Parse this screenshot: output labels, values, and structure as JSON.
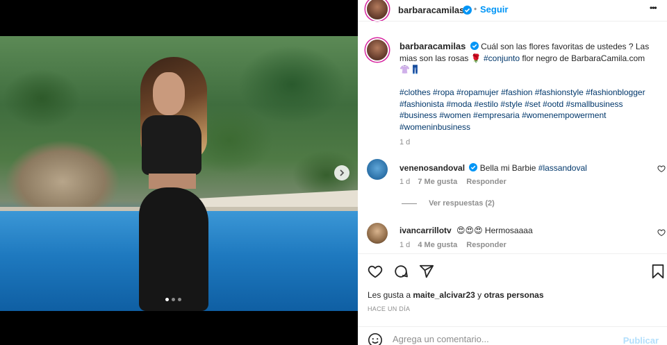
{
  "post": {
    "author": "barbaracamilas",
    "follow_label": "Seguir",
    "separator": "•",
    "more_label": "•••"
  },
  "caption": {
    "author": "barbaracamilas",
    "text_1": "Cuál son las flores favoritas de ustedes ? Las mias son las rosas 🌹",
    "hashtag_conjunto": "#conjunto",
    "text_2": "flor negro de BarbaraCamila.com 👚👖",
    "hashtags": "#clothes #ropa #ropamujer #fashion #fashionstyle #fashionblogger #fashionista #moda #estilo #style #set #ootd #smallbusiness #business #women #empresaria #womenempowerment #womeninbusiness",
    "time": "1 d"
  },
  "comments": [
    {
      "author": "venenosandoval",
      "verified": true,
      "text": "Bella mi Barbie",
      "mention": "#lassandoval",
      "time": "1 d",
      "likes": "7 Me gusta",
      "reply": "Responder"
    },
    {
      "author": "ivancarrillotv",
      "verified": false,
      "text": "😍😍😍 Hermosaaaa",
      "mention": "",
      "time": "1 d",
      "likes": "4 Me gusta",
      "reply": "Responder"
    }
  ],
  "replies_label": "Ver respuestas (2)",
  "likes_line": {
    "prefix": "Les gusta a",
    "user": "maite_alcivar23",
    "middle": "y",
    "others": "otras personas"
  },
  "time_ago": "HACE UN DÍA",
  "comment_box": {
    "placeholder": "Agrega un comentario...",
    "publish_label": "Publicar"
  },
  "carousel": {
    "current": 1,
    "total": 3
  },
  "colors": {
    "link": "#00376b",
    "accent": "#0095f6",
    "verified": "#0095f6",
    "muted": "#8e8e8e"
  },
  "icons": [
    "verified-badge-icon",
    "more-icon",
    "chevron-right-icon",
    "heart-icon",
    "comment-icon",
    "share-icon",
    "bookmark-icon",
    "emoji-icon"
  ]
}
